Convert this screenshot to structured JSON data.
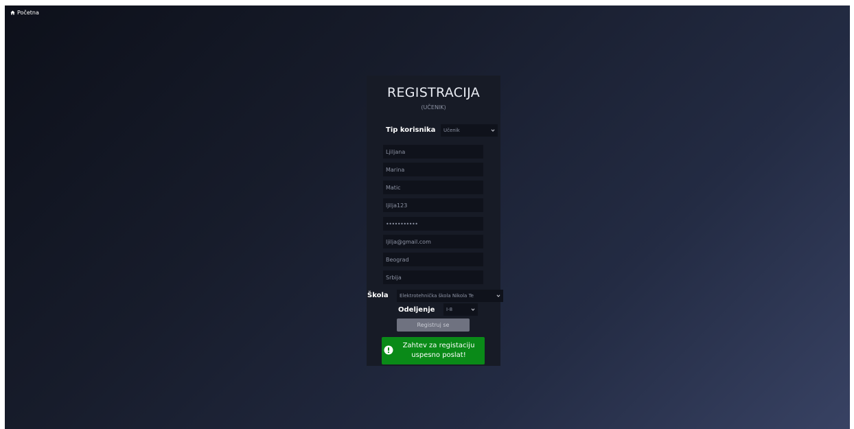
{
  "nav": {
    "home_label": "Početna",
    "home_icon": "home-icon"
  },
  "form": {
    "title": "REGISTRACIJA",
    "subtitle": "(UČENIK)",
    "user_type_label": "Tip korisnika",
    "user_type_value": "Učenik",
    "fields": {
      "first_name": "Ljiljana",
      "middle_name": "Marina",
      "last_name": "Matic",
      "username": "ljilja123",
      "password": "•••••••••••",
      "email": "ljilja@gmail.com",
      "city": "Beograd",
      "country": "Srbija"
    },
    "school_label": "Škola",
    "school_value": "Elektrotehnička škola Nikola Te",
    "class_label": "Odeljenje",
    "class_value": "I-8",
    "submit_label": "Registruj se",
    "alert_message": "Zahtev za registaciju uspesno poslat!",
    "alert_icon": "exclamation-circle-icon",
    "colors": {
      "alert_bg": "#0a8a18",
      "card_bg": "#171b26",
      "field_bg": "#0f121b"
    }
  }
}
